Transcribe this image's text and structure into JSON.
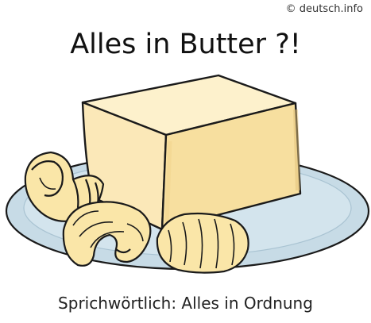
{
  "credit": "© deutsch.info",
  "title": "Alles in Butter ?!",
  "caption": "Sprichwörtlich: Alles in Ordnung",
  "colors": {
    "plate": "#c7dbe6",
    "plate_rim": "#a9c3d2",
    "butter_front": "#fbe8b8",
    "butter_top": "#fdf1cc",
    "butter_side": "#f1d495",
    "curl": "#fae6a8",
    "outline": "#1a1a1a"
  }
}
